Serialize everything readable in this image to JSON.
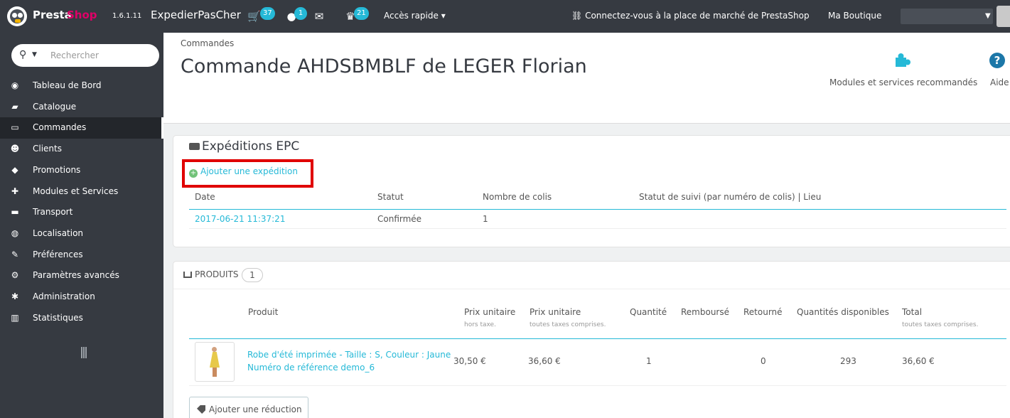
{
  "topbar": {
    "brand_a": "Presta",
    "brand_b": "Shop",
    "version": "1.6.1.11",
    "shop_name": "ExpedierPasCher",
    "badges": {
      "orders": "37",
      "customers": "1",
      "messages": "",
      "trophies": "21"
    },
    "quick_access": "Accès rapide ▾",
    "marketplace": "Connectez-vous à la place de marché de PrestaShop",
    "my_shop": "Ma Boutique"
  },
  "sidebar": {
    "search_placeholder": "Rechercher",
    "items": [
      {
        "label": "Tableau de Bord",
        "icon": "dashboard-icon",
        "glyph": "◉"
      },
      {
        "label": "Catalogue",
        "icon": "book-icon",
        "glyph": "▰"
      },
      {
        "label": "Commandes",
        "icon": "credit-card-icon",
        "glyph": "▭"
      },
      {
        "label": "Clients",
        "icon": "users-icon",
        "glyph": "☻"
      },
      {
        "label": "Promotions",
        "icon": "tag-icon",
        "glyph": "◆"
      },
      {
        "label": "Modules et Services",
        "icon": "puzzle-icon",
        "glyph": "✚"
      },
      {
        "label": "Transport",
        "icon": "truck-icon",
        "glyph": "▬"
      },
      {
        "label": "Localisation",
        "icon": "globe-icon",
        "glyph": "◍"
      },
      {
        "label": "Préférences",
        "icon": "wrench-icon",
        "glyph": "✎"
      },
      {
        "label": "Paramètres avancés",
        "icon": "cogs-icon",
        "glyph": "⚙"
      },
      {
        "label": "Administration",
        "icon": "gear-icon",
        "glyph": "✱"
      },
      {
        "label": "Statistiques",
        "icon": "bar-chart-icon",
        "glyph": "▥"
      }
    ],
    "active_index": 2
  },
  "header": {
    "breadcrumb": "Commandes",
    "title": "Commande AHDSBMBLF de LEGER Florian",
    "modules_label": "Modules et services recommandés",
    "help_label": "Aide",
    "help_glyph": "?"
  },
  "expeditions": {
    "title": "Expéditions EPC",
    "add_link": "Ajouter une expédition",
    "columns": [
      "Date",
      "Statut",
      "Nombre de colis",
      "Statut de suivi (par numéro de colis) | Lieu"
    ],
    "rows": [
      {
        "date": "2017-06-21 11:37:21",
        "status": "Confirmée",
        "packages": "1",
        "tracking": ""
      }
    ]
  },
  "products": {
    "header": "Produits",
    "count": "1",
    "columns": [
      {
        "label": "Produit",
        "sub": ""
      },
      {
        "label": "Prix unitaire",
        "sub": "hors taxe."
      },
      {
        "label": "Prix unitaire",
        "sub": "toutes taxes comprises."
      },
      {
        "label": "Quantité",
        "sub": ""
      },
      {
        "label": "Remboursé",
        "sub": ""
      },
      {
        "label": "Retourné",
        "sub": ""
      },
      {
        "label": "Quantités disponibles",
        "sub": ""
      },
      {
        "label": "Total",
        "sub": "toutes taxes comprises."
      }
    ],
    "rows": [
      {
        "name": "Robe d'été imprimée - Taille : S, Couleur : Jaune",
        "reference": "Numéro de référence demo_6",
        "price_ht": "30,50 €",
        "price_ttc": "36,60 €",
        "quantity": "1",
        "refunded": "",
        "returned": "0",
        "available": "293",
        "total": "36,60 €"
      }
    ],
    "add_discount": "Ajouter une réduction"
  },
  "colors": {
    "sidebar_bg": "#363a41",
    "accent": "#25b9d7",
    "brand_pink": "#df0067",
    "highlight_red": "#e00000"
  }
}
